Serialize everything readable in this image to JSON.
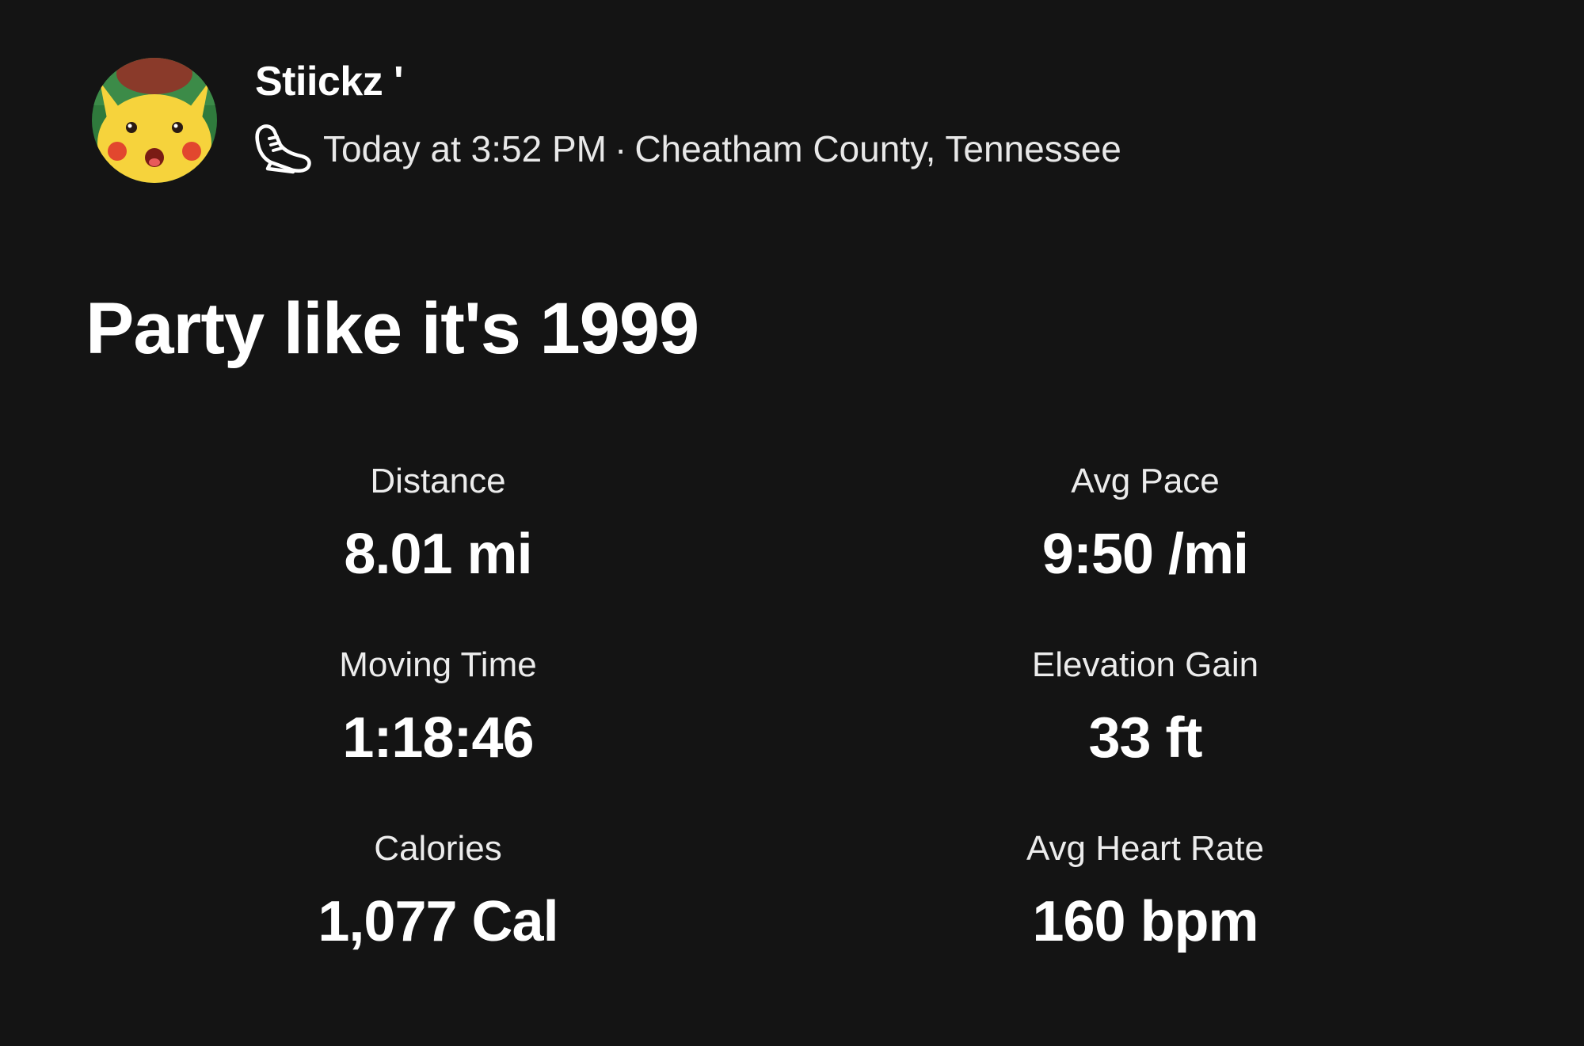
{
  "athlete": {
    "name": "Stiickz '",
    "avatar_icon": "pikachu-avatar-icon"
  },
  "activity": {
    "sport_icon": "running-shoe-icon",
    "timestamp": "Today at 3:52 PM",
    "separator": "·",
    "location": "Cheatham County, Tennessee",
    "title": "Party like it's 1999"
  },
  "stats": [
    {
      "label": "Distance",
      "value": "8.01 mi"
    },
    {
      "label": "Avg Pace",
      "value": "9:50 /mi"
    },
    {
      "label": "Moving Time",
      "value": "1:18:46"
    },
    {
      "label": "Elevation Gain",
      "value": "33 ft"
    },
    {
      "label": "Calories",
      "value": "1,077 Cal"
    },
    {
      "label": "Avg Heart Rate",
      "value": "160 bpm"
    }
  ],
  "colors": {
    "background": "#141414",
    "text": "#ffffff"
  }
}
